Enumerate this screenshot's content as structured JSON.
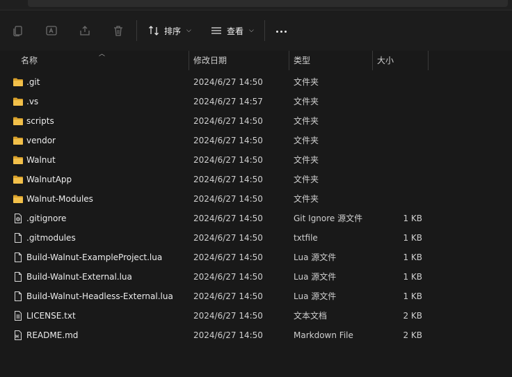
{
  "toolbar": {
    "sort_label": "排序",
    "view_label": "查看"
  },
  "columns": {
    "name": "名称",
    "modified": "修改日期",
    "type": "类型",
    "size": "大小"
  },
  "files": [
    {
      "icon": "folder-icon",
      "name": ".git",
      "modified": "2024/6/27 14:50",
      "type": "文件夹",
      "size": ""
    },
    {
      "icon": "folder-icon",
      "name": ".vs",
      "modified": "2024/6/27 14:57",
      "type": "文件夹",
      "size": ""
    },
    {
      "icon": "folder-icon",
      "name": "scripts",
      "modified": "2024/6/27 14:50",
      "type": "文件夹",
      "size": ""
    },
    {
      "icon": "folder-icon",
      "name": "vendor",
      "modified": "2024/6/27 14:50",
      "type": "文件夹",
      "size": ""
    },
    {
      "icon": "folder-icon",
      "name": "Walnut",
      "modified": "2024/6/27 14:50",
      "type": "文件夹",
      "size": ""
    },
    {
      "icon": "folder-icon",
      "name": "WalnutApp",
      "modified": "2024/6/27 14:50",
      "type": "文件夹",
      "size": ""
    },
    {
      "icon": "folder-icon",
      "name": "Walnut-Modules",
      "modified": "2024/6/27 14:50",
      "type": "文件夹",
      "size": ""
    },
    {
      "icon": "settings-file-icon",
      "name": ".gitignore",
      "modified": "2024/6/27 14:50",
      "type": "Git Ignore 源文件",
      "size": "1 KB"
    },
    {
      "icon": "file-icon",
      "name": ".gitmodules",
      "modified": "2024/6/27 14:50",
      "type": "txtfile",
      "size": "1 KB"
    },
    {
      "icon": "file-icon",
      "name": "Build-Walnut-ExampleProject.lua",
      "modified": "2024/6/27 14:50",
      "type": "Lua 源文件",
      "size": "1 KB"
    },
    {
      "icon": "file-icon",
      "name": "Build-Walnut-External.lua",
      "modified": "2024/6/27 14:50",
      "type": "Lua 源文件",
      "size": "1 KB"
    },
    {
      "icon": "file-icon",
      "name": "Build-Walnut-Headless-External.lua",
      "modified": "2024/6/27 14:50",
      "type": "Lua 源文件",
      "size": "1 KB"
    },
    {
      "icon": "text-file-icon",
      "name": "LICENSE.txt",
      "modified": "2024/6/27 14:50",
      "type": "文本文档",
      "size": "2 KB"
    },
    {
      "icon": "markdown-file-icon",
      "name": "README.md",
      "modified": "2024/6/27 14:50",
      "type": "Markdown File",
      "size": "2 KB"
    }
  ],
  "colors": {
    "background": "#191919",
    "folder": "#e8b339",
    "text": "#ececec"
  }
}
